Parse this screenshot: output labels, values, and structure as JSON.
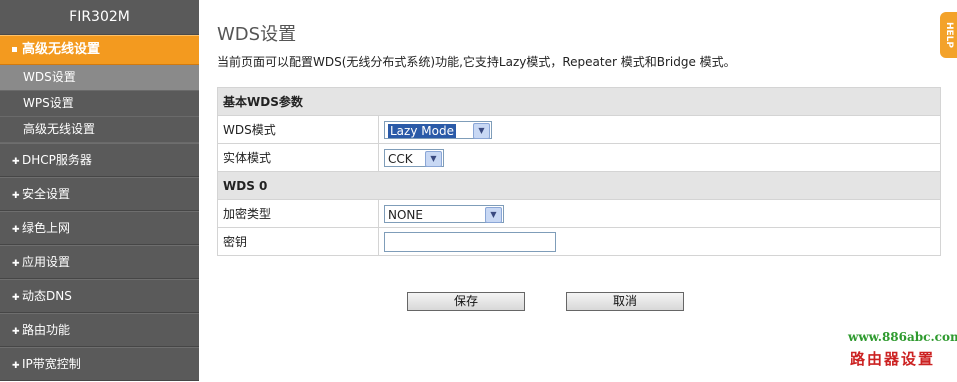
{
  "sidebar": {
    "model": "FIR302M",
    "active_section": "高级无线设置",
    "sub_items": [
      "WDS设置",
      "WPS设置",
      "高级无线设置"
    ],
    "nav_items": [
      "DHCP服务器",
      "安全设置",
      "绿色上网",
      "应用设置",
      "动态DNS",
      "路由功能",
      "IP带宽控制"
    ]
  },
  "page": {
    "title": "WDS设置",
    "description": "当前页面可以配置WDS(无线分布式系统)功能,它支持Lazy模式，Repeater 模式和Bridge 模式。"
  },
  "table": {
    "section1": "基本WDS参数",
    "wds_mode_label": "WDS模式",
    "wds_mode_value": "Lazy Mode",
    "phy_mode_label": "实体模式",
    "phy_mode_value": "CCK",
    "section2": "WDS 0",
    "enc_label": "加密类型",
    "enc_value": "NONE",
    "key_label": "密钥",
    "key_value": ""
  },
  "buttons": {
    "save": "保存",
    "cancel": "取消"
  },
  "help": "HELP",
  "watermark": {
    "url": "www.886abc.com",
    "text": "路由器设置"
  }
}
